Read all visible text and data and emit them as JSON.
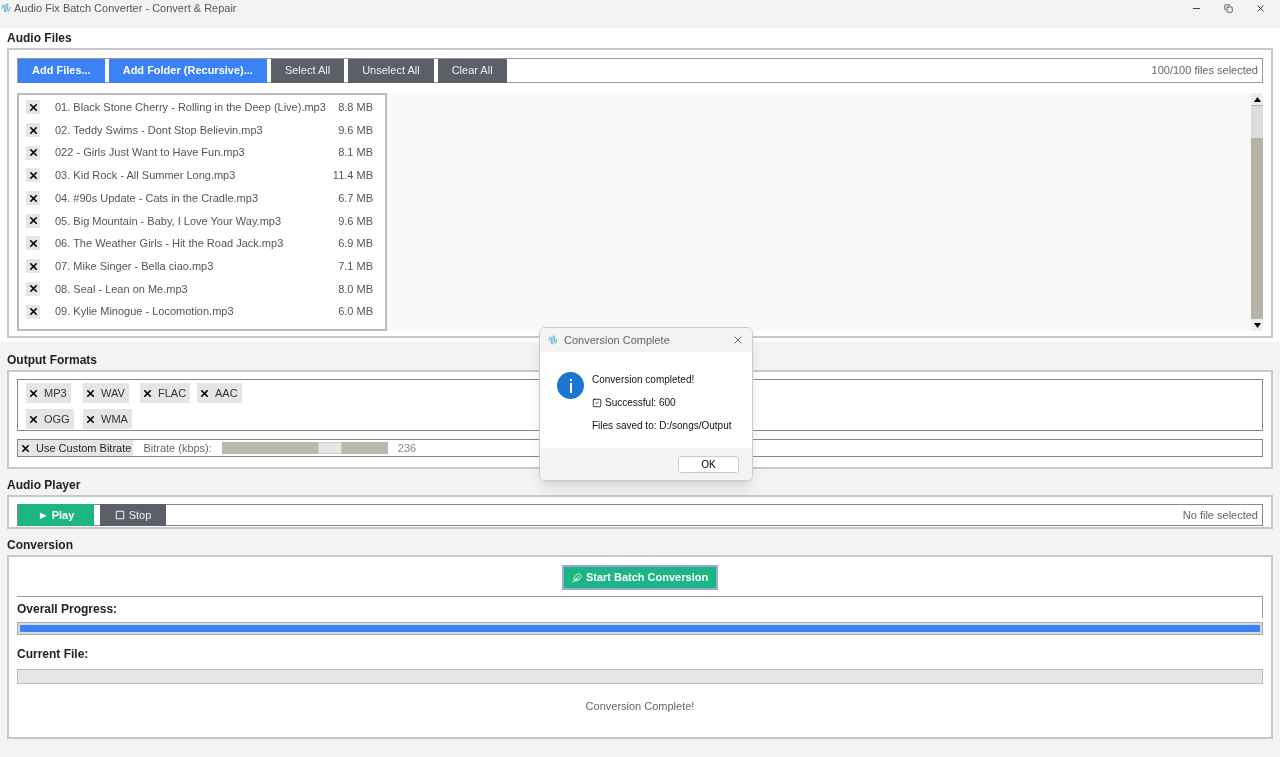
{
  "window": {
    "title": "Audio Fix Batch Converter - Convert & Repair"
  },
  "audio_files": {
    "heading": "Audio Files",
    "buttons": [
      {
        "label": "Add Files...",
        "kind": "primary"
      },
      {
        "label": "Add Folder (Recursive)...",
        "kind": "primary"
      },
      {
        "label": "Select All",
        "kind": "secondary"
      },
      {
        "label": "Unselect All",
        "kind": "secondary"
      },
      {
        "label": "Clear All",
        "kind": "secondary"
      }
    ],
    "selection_count": "100/100 files selected",
    "files": [
      {
        "name": "01. Black Stone Cherry - Rolling in the Deep (Live).mp3",
        "size": "8.8 MB",
        "checked": true
      },
      {
        "name": "02. Teddy Swims - Dont Stop Believin.mp3",
        "size": "9.6 MB",
        "checked": true
      },
      {
        "name": "022 - Girls Just Want to Have Fun.mp3",
        "size": "8.1 MB",
        "checked": true
      },
      {
        "name": "03. Kid Rock - All Summer Long.mp3",
        "size": "11.4 MB",
        "checked": true
      },
      {
        "name": "04. #90s Update - Cats in the Cradle.mp3",
        "size": "6.7 MB",
        "checked": true
      },
      {
        "name": "05. Big Mountain - Baby, I Love Your Way.mp3",
        "size": "9.6 MB",
        "checked": true
      },
      {
        "name": "06. The Weather Girls - Hit the Road Jack.mp3",
        "size": "6.9 MB",
        "checked": true
      },
      {
        "name": "07. Mike Singer - Bella ciao.mp3",
        "size": "7.1 MB",
        "checked": true
      },
      {
        "name": "08. Seal - Lean on Me.mp3",
        "size": "8.0 MB",
        "checked": true
      },
      {
        "name": "09. Kylie Minogue - Locomotion.mp3",
        "size": "6.0 MB",
        "checked": true
      }
    ]
  },
  "output_formats": {
    "heading": "Output Formats",
    "formats": [
      {
        "label": "MP3",
        "checked": true
      },
      {
        "label": "WAV",
        "checked": true
      },
      {
        "label": "FLAC",
        "checked": true
      },
      {
        "label": "AAC",
        "checked": true
      },
      {
        "label": "OGG",
        "checked": true
      },
      {
        "label": "WMA",
        "checked": true
      }
    ],
    "custom_bitrate": {
      "label": "Use Custom Bitrate",
      "checked": true
    },
    "bitrate": {
      "label": "Bitrate (kbps):",
      "level": 0.65,
      "reading": "236"
    }
  },
  "audio_player": {
    "heading": "Audio Player",
    "play_button": "► Play",
    "stop_button": "Stop",
    "status": "No file selected"
  },
  "conversion": {
    "heading": "Conversion",
    "start_button": "Start Batch Conversion",
    "overall_label": "Overall Progress:",
    "overall": {
      "level": 1
    },
    "current_label": "Current File:",
    "status": "Conversion Complete!"
  },
  "dialog": {
    "title": "Conversion Complete",
    "message": "Conversion completed!",
    "success": "Successful: 600",
    "saved": "Files saved to: D:/songs/Output",
    "ok_button": "OK"
  }
}
